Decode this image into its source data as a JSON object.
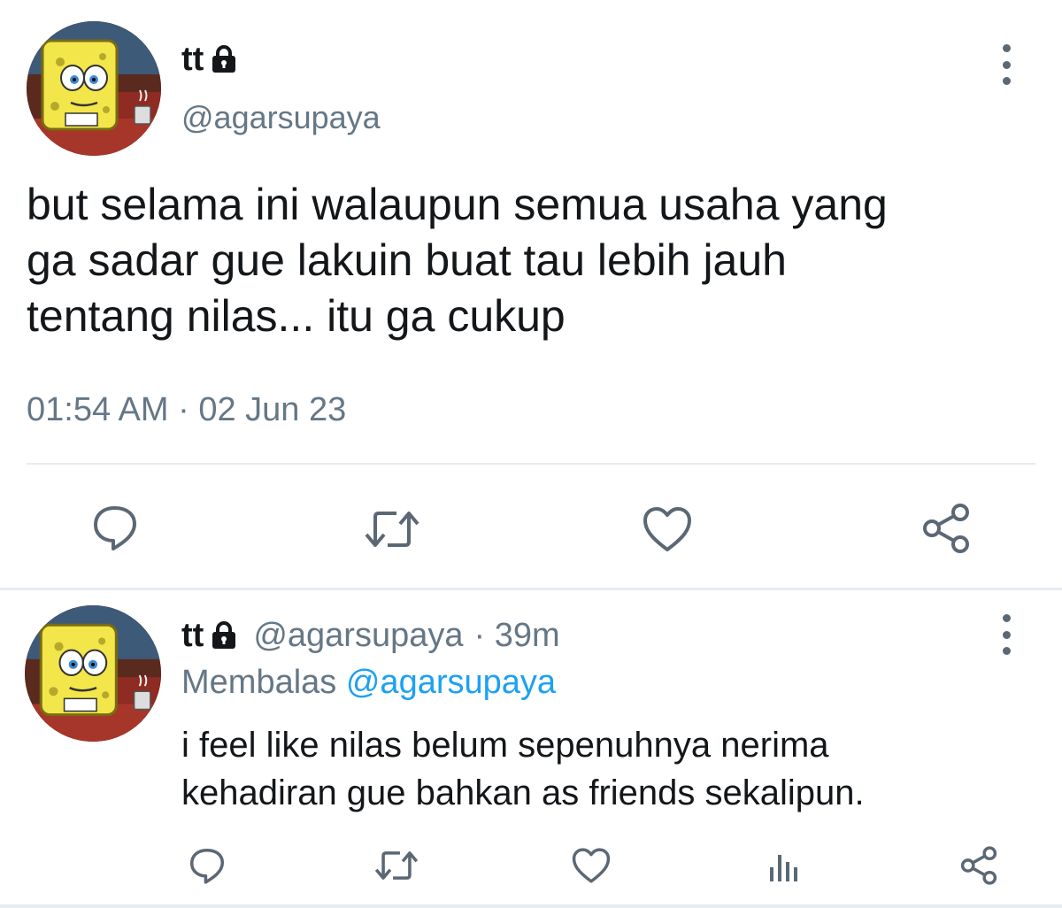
{
  "main_tweet": {
    "display_name": "tt",
    "handle": "@agarsupaya",
    "text": "but selama ini walaupun semua usaha yang\nga sadar gue lakuin buat tau lebih jauh\ntentang nilas... itu ga cukup",
    "timestamp": "01:54 AM · 02 Jun 23",
    "icons": [
      "lock-icon",
      "kebab-menu-icon",
      "reply-icon",
      "retweet-icon",
      "like-icon",
      "share-icon"
    ]
  },
  "reply_tweet": {
    "display_name": "tt",
    "handle": "@agarsupaya",
    "time_ago": "· 39m",
    "replying_label": "Membalas",
    "replying_to": "@agarsupaya",
    "text": "i feel like nilas belum sepenuhnya nerima\nkehadiran gue bahkan as friends sekalipun.",
    "icons": [
      "lock-icon",
      "kebab-menu-icon",
      "reply-icon",
      "retweet-icon",
      "like-icon",
      "analytics-icon",
      "share-icon"
    ]
  },
  "colors": {
    "text": "#14171a",
    "secondary_text": "#657786",
    "mention": "#1da1f2",
    "icon": "#5b6874",
    "divider": "#e6ecf0"
  }
}
